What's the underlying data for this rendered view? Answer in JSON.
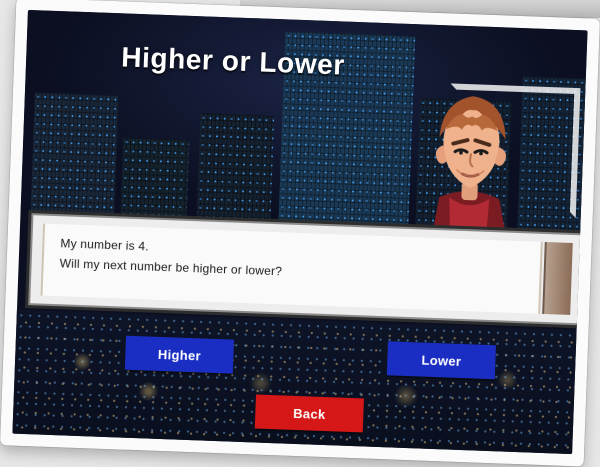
{
  "game": {
    "title": "Higher or Lower",
    "dialog": {
      "line1": "My number is 4.",
      "line2": "Will my next number be higher or lower?"
    },
    "buttons": {
      "higher": "Higher",
      "lower": "Lower",
      "back": "Back"
    },
    "icons": {
      "character": "trainer-portrait-icon"
    },
    "colors": {
      "button_primary": "#1b2ec3",
      "button_danger": "#d51717",
      "dialog_bg": "#ededed"
    }
  }
}
